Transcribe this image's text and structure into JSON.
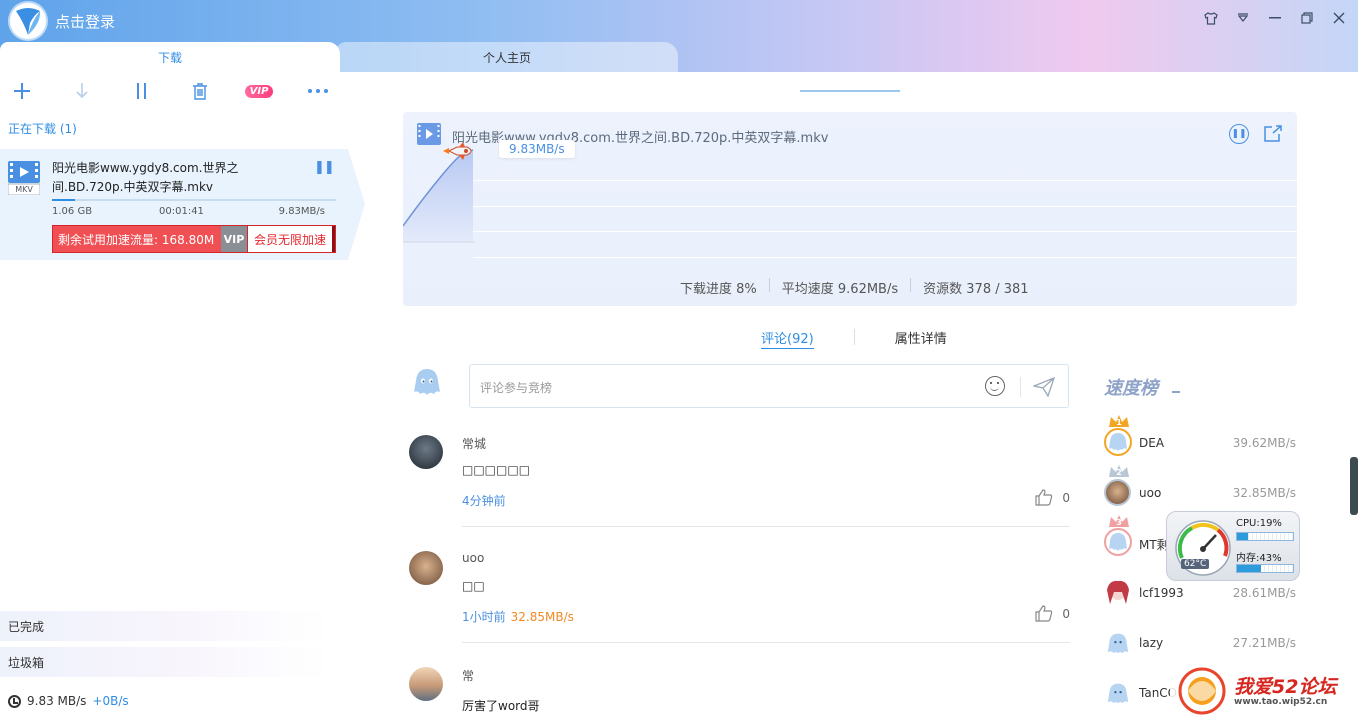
{
  "app": {
    "login_text": "点击登录"
  },
  "tabs": {
    "download": "下载",
    "home": "个人主页"
  },
  "toolbar": {
    "vip_label": "VIP"
  },
  "left": {
    "downloading_label": "正在下载 (1)",
    "item": {
      "icon_label": "MKV",
      "title": "阳光电影www.ygdy8.com.世界之间.BD.720p.中英双字幕.mkv",
      "size": "1.06 GB",
      "remaining_time": "00:01:41",
      "speed": "9.83MB/s",
      "progress_fraction": 0.08,
      "trial_text": "剩余试用加速流量: 168.80M",
      "vip_tag": "VIP",
      "vip_action": "会员无限加速"
    },
    "completed_label": "已完成",
    "trash_label": "垃圾箱",
    "bottom_speed": "9.83 MB/s",
    "bottom_up": "+0B/s"
  },
  "graph": {
    "title": "阳光电影www.ygdy8.com.世界之间.BD.720p.中英双字幕.mkv",
    "current_speed": "9.83MB/s",
    "progress_label": "下载进度 8%",
    "avg_speed_label": "平均速度 9.62MB/s",
    "sources_label": "资源数 378 / 381"
  },
  "detail_tabs": {
    "comments": "评论(92)",
    "properties": "属性详情"
  },
  "comment_input": {
    "placeholder": "评论参与竞榜"
  },
  "comments": [
    {
      "name": "常城",
      "body": "□□□□□□",
      "time": "4分钟前",
      "speed": "",
      "likes": "0"
    },
    {
      "name": "uoo",
      "body": "□□",
      "time": "1小时前",
      "speed": "32.85MB/s",
      "likes": "0"
    },
    {
      "name": "常",
      "body": "厉害了word哥",
      "time": "",
      "speed": "",
      "likes": ""
    }
  ],
  "ranking": {
    "title": "速度榜",
    "rows": [
      {
        "rank": "1",
        "name": "DEA",
        "speed": "39.62MB/s"
      },
      {
        "rank": "2",
        "name": "uoo",
        "speed": "32.85MB/s"
      },
      {
        "rank": "3",
        "name": "MT剩",
        "speed": ""
      },
      {
        "rank": "",
        "name": "lcf1993",
        "speed": "28.61MB/s"
      },
      {
        "rank": "",
        "name": "lazy",
        "speed": "27.21MB/s"
      },
      {
        "rank": "",
        "name": "TanCO",
        "speed": ""
      }
    ]
  },
  "system_monitor": {
    "cpu": "CPU:19%",
    "cpu_fraction": 0.19,
    "memory": "内存:43%",
    "memory_fraction": 0.43,
    "temp": "62°C"
  },
  "watermark": {
    "name": "我爱52论坛",
    "url": "www.tao.wip52.cn"
  },
  "colors": {
    "accent": "#2f8de4",
    "danger": "#f05054",
    "orange": "#f08a24"
  }
}
